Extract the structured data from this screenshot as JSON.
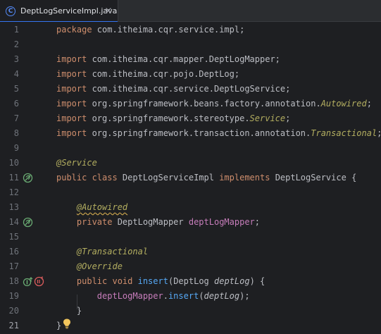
{
  "tab": {
    "file_name": "DeptLogServiceImpl.java",
    "icon_letter": "C",
    "active": true
  },
  "colors": {
    "background": "#1e1f22",
    "keyword": "#cf8e6d",
    "annotation": "#b3ae60",
    "method": "#56a8f5",
    "field": "#c77dbb",
    "text": "#bcbec4",
    "line_number": "#6f737a",
    "accent": "#3574f0"
  },
  "lines": [
    {
      "num": "1",
      "gutter_icon": "",
      "tokens": [
        [
          "kw",
          "package "
        ],
        [
          "pl",
          "com.itheima.cqr.service.impl;"
        ]
      ]
    },
    {
      "num": "2",
      "gutter_icon": "",
      "tokens": []
    },
    {
      "num": "3",
      "gutter_icon": "",
      "tokens": [
        [
          "kw",
          "import "
        ],
        [
          "pl",
          "com.itheima.cqr.mapper.DeptLogMapper;"
        ]
      ]
    },
    {
      "num": "4",
      "gutter_icon": "",
      "tokens": [
        [
          "kw",
          "import "
        ],
        [
          "pl",
          "com.itheima.cqr.pojo.DeptLog;"
        ]
      ]
    },
    {
      "num": "5",
      "gutter_icon": "",
      "tokens": [
        [
          "kw",
          "import "
        ],
        [
          "pl",
          "com.itheima.cqr.service.DeptLogService;"
        ]
      ]
    },
    {
      "num": "6",
      "gutter_icon": "",
      "tokens": [
        [
          "kw",
          "import "
        ],
        [
          "pl",
          "org.springframework.beans.factory.annotation."
        ],
        [
          "ann",
          "Autowired"
        ],
        [
          "pl",
          ";"
        ]
      ]
    },
    {
      "num": "7",
      "gutter_icon": "",
      "tokens": [
        [
          "kw",
          "import "
        ],
        [
          "pl",
          "org.springframework.stereotype."
        ],
        [
          "ann",
          "Service"
        ],
        [
          "pl",
          ";"
        ]
      ]
    },
    {
      "num": "8",
      "gutter_icon": "",
      "tokens": [
        [
          "kw",
          "import "
        ],
        [
          "pl",
          "org.springframework.transaction.annotation."
        ],
        [
          "ann",
          "Transactional"
        ],
        [
          "pl",
          ";"
        ]
      ]
    },
    {
      "num": "9",
      "gutter_icon": "",
      "tokens": []
    },
    {
      "num": "10",
      "gutter_icon": "",
      "tokens": [
        [
          "ann",
          "@Service"
        ]
      ]
    },
    {
      "num": "11",
      "gutter_icon": "bean-icon",
      "tokens": [
        [
          "kw",
          "public class "
        ],
        [
          "pl",
          "DeptLogServiceImpl "
        ],
        [
          "kw",
          "implements "
        ],
        [
          "pl",
          "DeptLogService "
        ],
        [
          "pl",
          "{"
        ]
      ]
    },
    {
      "num": "12",
      "gutter_icon": "",
      "tokens": []
    },
    {
      "num": "13",
      "gutter_icon": "",
      "tokens": [
        [
          "pl",
          "    "
        ],
        [
          "annw",
          "@Autowired"
        ]
      ]
    },
    {
      "num": "14",
      "gutter_icon": "bean-icon",
      "tokens": [
        [
          "pl",
          "    "
        ],
        [
          "kw",
          "private "
        ],
        [
          "pl",
          "DeptLogMapper "
        ],
        [
          "field",
          "deptLogMapper"
        ],
        [
          "pl",
          ";"
        ]
      ]
    },
    {
      "num": "15",
      "gutter_icon": "",
      "tokens": []
    },
    {
      "num": "16",
      "gutter_icon": "",
      "tokens": [
        [
          "pl",
          "    "
        ],
        [
          "ann",
          "@Transactional"
        ]
      ]
    },
    {
      "num": "17",
      "gutter_icon": "",
      "tokens": [
        [
          "pl",
          "    "
        ],
        [
          "ann",
          "@Override"
        ]
      ]
    },
    {
      "num": "18",
      "gutter_icon": "implements-override-icons",
      "tokens": [
        [
          "pl",
          "    "
        ],
        [
          "kw",
          "public void "
        ],
        [
          "fn",
          "insert"
        ],
        [
          "pl",
          "(DeptLog "
        ],
        [
          "param",
          "deptLog"
        ],
        [
          "pl",
          ") {"
        ]
      ]
    },
    {
      "num": "19",
      "gutter_icon": "",
      "tokens": [
        [
          "pl",
          "        "
        ],
        [
          "field",
          "deptLogMapper"
        ],
        [
          "pl",
          "."
        ],
        [
          "fn",
          "insert"
        ],
        [
          "pl",
          "("
        ],
        [
          "param",
          "deptLog"
        ],
        [
          "pl",
          ");"
        ]
      ]
    },
    {
      "num": "20",
      "gutter_icon": "",
      "tokens": [
        [
          "pl",
          "    }"
        ]
      ]
    },
    {
      "num": "21",
      "gutter_icon": "",
      "tokens": [
        [
          "pl",
          "}"
        ]
      ]
    }
  ],
  "active_line": "21"
}
